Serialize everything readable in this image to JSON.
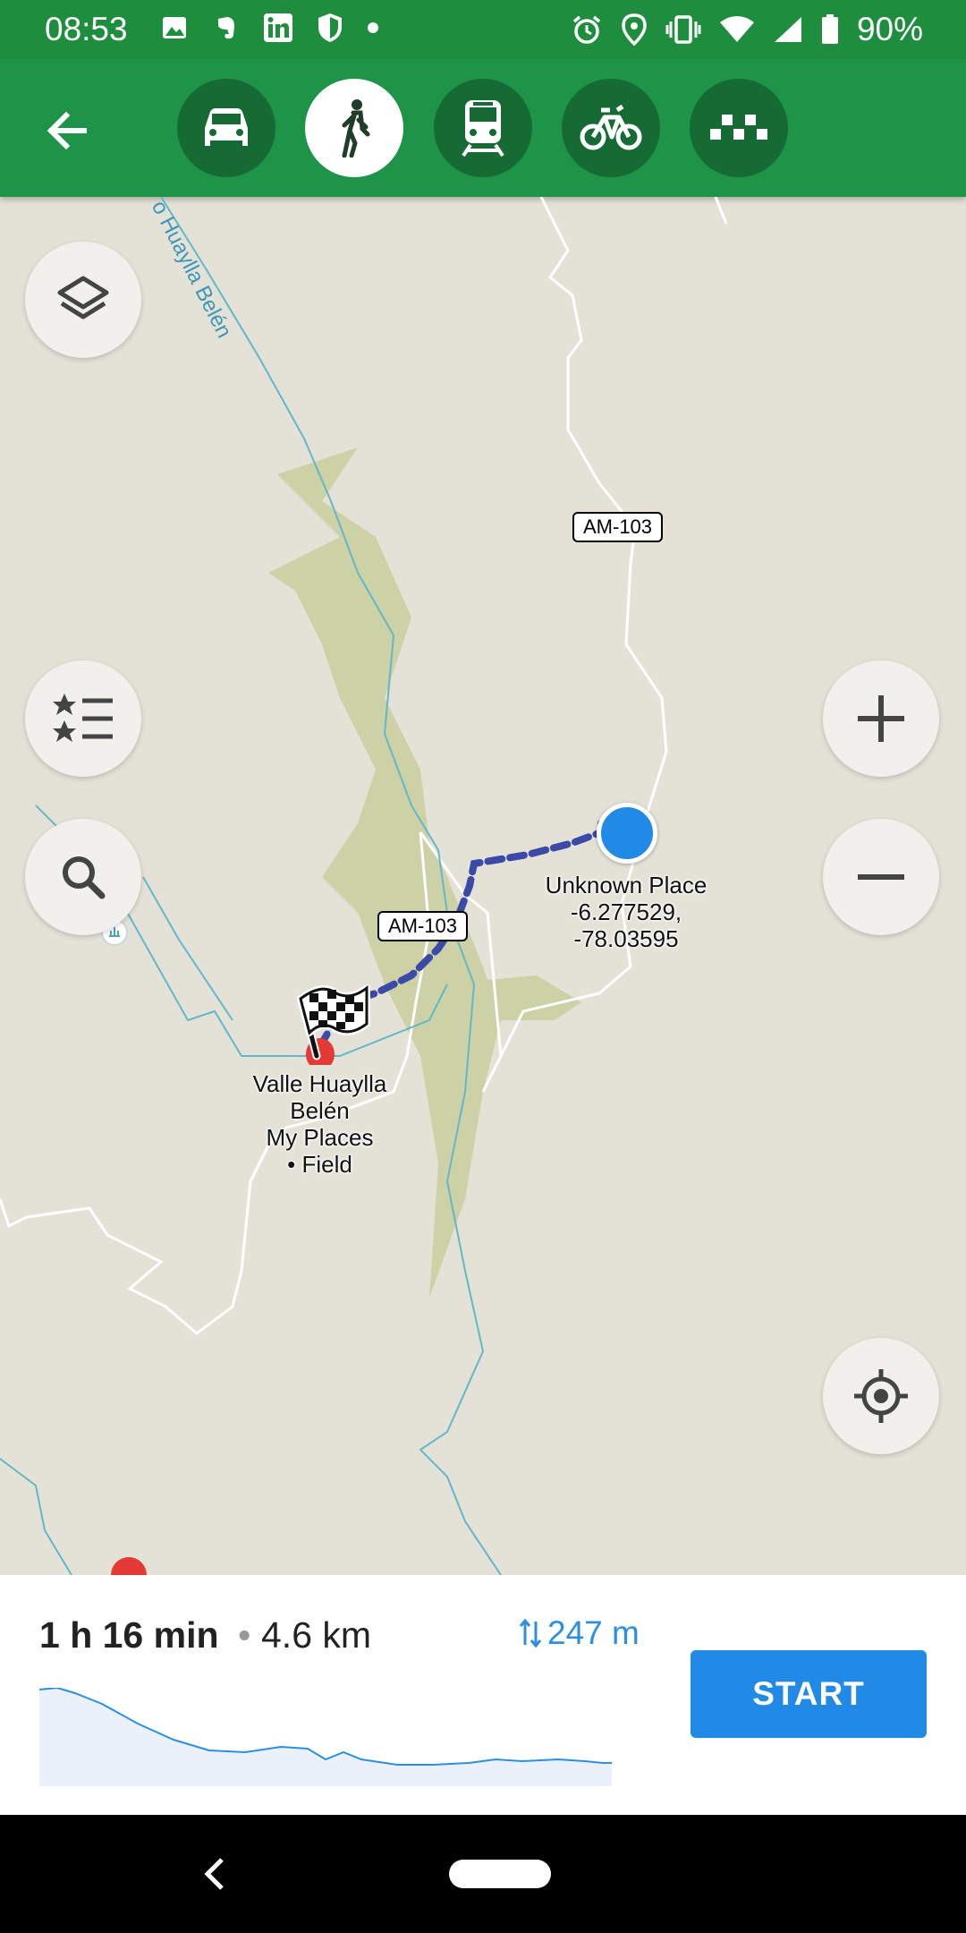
{
  "status": {
    "time": "08:53",
    "battery": "90%",
    "left_icons": [
      "image-icon",
      "evernote-icon",
      "linkedin-icon",
      "shield-icon",
      "dot-icon"
    ],
    "right_icons": [
      "alarm-icon",
      "location-icon",
      "vibrate-icon",
      "wifi-icon",
      "signal-icon",
      "battery-icon"
    ]
  },
  "toolbar": {
    "back_icon": "arrow-back-icon",
    "modes": [
      {
        "name": "car",
        "icon": "car-icon",
        "active": false
      },
      {
        "name": "walk",
        "icon": "walk-icon",
        "active": true
      },
      {
        "name": "transit",
        "icon": "train-icon",
        "active": false
      },
      {
        "name": "bike",
        "icon": "bike-icon",
        "active": false
      },
      {
        "name": "taxi",
        "icon": "taxi-icon",
        "active": false
      }
    ]
  },
  "map": {
    "road_labels": [
      "AM-103",
      "AM-103"
    ],
    "river_label": "o Huaylla Belén",
    "origin": {
      "name": "Unknown Place",
      "coords_line1": "-6.277529,",
      "coords_line2": "-78.03595"
    },
    "destination": {
      "name_line1": "Valle Huaylla",
      "name_line2": "Belén",
      "sub_line1": "My Places",
      "sub_line2": "• Field"
    },
    "colors": {
      "route": "#3b4aa8",
      "river": "#62b8c8",
      "origin_dot": "#2189e6",
      "vegetation": "#ccd2a6"
    }
  },
  "route_summary": {
    "duration": "1 h 16 min",
    "separator": "•",
    "distance": "4.6 km",
    "elevation": "247 m",
    "start_label": "START"
  }
}
